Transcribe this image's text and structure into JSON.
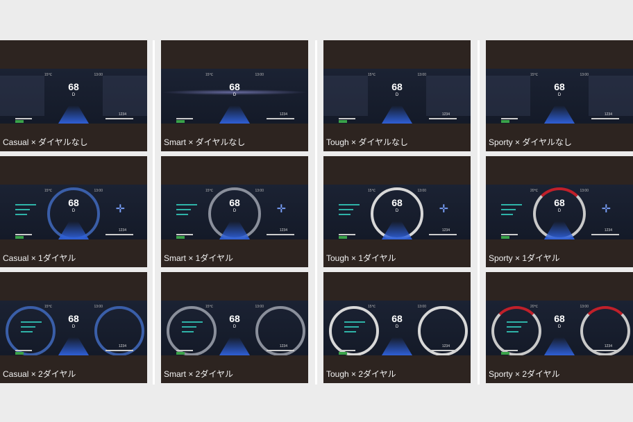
{
  "shared_screen": {
    "speed": "68",
    "gear": "D",
    "temperature": "15℃",
    "clock": "13:00",
    "odometer": "1234"
  },
  "tiles": [
    {
      "caption": "Casual × ダイヤルなし"
    },
    {
      "caption": "Smart × ダイヤルなし"
    },
    {
      "caption": "Tough × ダイヤルなし"
    },
    {
      "caption": "Sporty × ダイヤルなし"
    },
    {
      "caption": "Casual × 1ダイヤル"
    },
    {
      "caption": "Smart × 1ダイヤル"
    },
    {
      "caption": "Tough × 1ダイヤル"
    },
    {
      "caption": "Sporty × 1ダイヤル"
    },
    {
      "caption": "Casual × 2ダイヤル"
    },
    {
      "caption": "Smart × 2ダイヤル"
    },
    {
      "caption": "Tough × 2ダイヤル"
    },
    {
      "caption": "Sporty × 2ダイヤル"
    }
  ],
  "sporty_temperature": "20℃",
  "colors": {
    "page_bg": "#ececec",
    "tile_bg": "#2d2420",
    "screen_bg": "#141a28",
    "accent_blue": "#2e5fd6",
    "accent_red": "#c0202a",
    "indicator_green": "#3ba34a"
  }
}
